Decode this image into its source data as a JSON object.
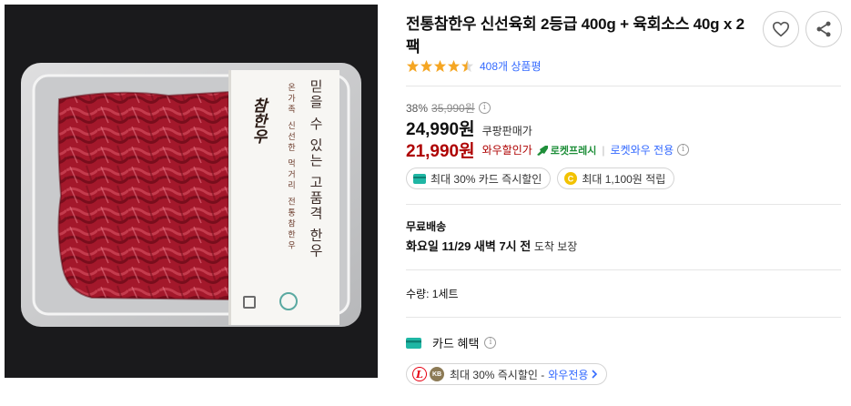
{
  "product": {
    "title": "전통참한우 신선육회 2등급 400g + 육회소스 40g x 2팩",
    "rating_value": 4.5,
    "review_count": "408개 상품평",
    "image": {
      "package_vertical_main": "믿을 수 있는 고품격 한우",
      "package_vertical_sub": "온가족 신선한 먹거리 전통참한우",
      "brand_logo_text": "참한우"
    }
  },
  "pricing": {
    "discount_rate": "38%",
    "original_price": "35,990원",
    "sale_price": "24,990원",
    "sale_label": "쿠팡판매가",
    "wow_price": "21,990원",
    "wow_label": "와우할인가",
    "fresh_badge": "로켓프레시",
    "rocket_wow": "로켓와우 전용"
  },
  "benefits": {
    "card_chip": "최대 30% 카드 즉시할인",
    "cash_chip": "최대 1,100원 적립"
  },
  "shipping": {
    "title": "무료배송",
    "date_bold": "화요일 11/29 새벽 7시 전",
    "guarantee": "도착 보장"
  },
  "quantity": {
    "label": "수량:",
    "value": "1세트"
  },
  "card_benefit": {
    "title": "카드 혜택",
    "promo_text": "최대 30% 즉시할인 -",
    "promo_link": "와우전용"
  },
  "colors": {
    "wow_red": "#ae0000",
    "link_blue": "#346aff",
    "star_orange": "#f5a623",
    "fresh_green": "#1f8f3a",
    "card_teal": "#1fb6a4"
  }
}
